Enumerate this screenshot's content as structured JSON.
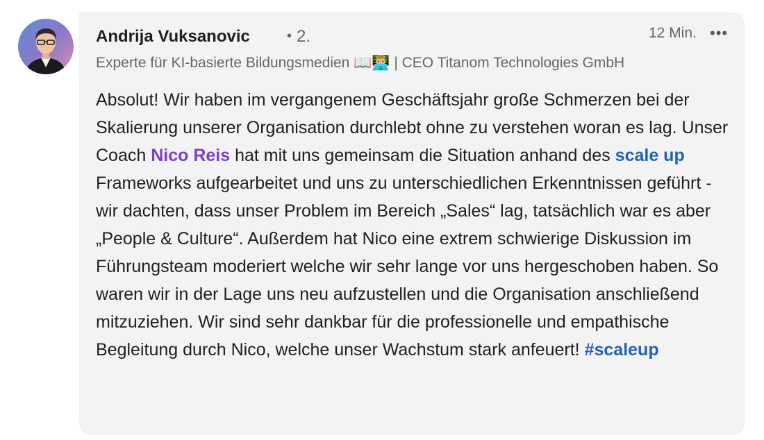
{
  "comment": {
    "author": {
      "name": "Andrija Vuksanovic",
      "degree": "2.",
      "headline": "Experte für KI-basierte Bildungsmedien 📖👨🏼‍💻 | CEO Titanom Technologies GmbH"
    },
    "timestamp": "12 Min.",
    "more_icon": "•••",
    "body": {
      "seg1": "Absolut! Wir haben im vergangenem Geschäftsjahr große Schmerzen bei der Skalierung unserer Organisation durchlebt ohne zu verstehen woran es lag. Unser Coach ",
      "mention": "Nico Reis",
      "seg2": " hat mit uns gemeinsam die Situation anhand des ",
      "link": "scale up",
      "seg3": " Frameworks aufgearbeitet und uns zu unterschiedlichen Erkenntnissen geführt - wir dachten, dass unser Problem im Bereich „Sales“ lag, tatsächlich war es aber „People & Culture“. Außerdem hat Nico eine extrem schwierige Diskussion im Führungsteam moderiert welche wir sehr lange vor uns hergeschoben haben. So waren wir in der Lage uns neu aufzustellen und die Organisation anschließend mitzuziehen. Wir sind sehr dankbar für die professionelle und empathische Begleitung durch Nico, welche unser Wachstum stark anfeuert! ",
      "hashtag": "#scaleup"
    }
  },
  "colors": {
    "bubble": "#f3f3f3",
    "mention": "#7d3fc8",
    "link": "#1f63b9",
    "secondary_text": "#666666"
  }
}
